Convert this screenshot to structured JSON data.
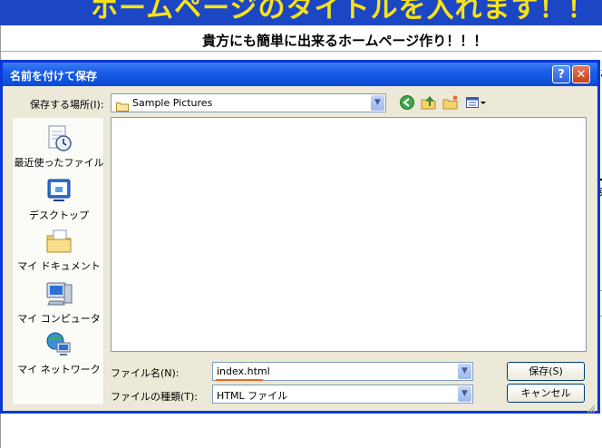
{
  "background_page": {
    "banner_title": "ホームページのタイトルを入れます！！",
    "subtitle": "貴方にも簡単に出来るホームページ作り！！！",
    "side_fragments": [
      "に",
      "い",
      "す"
    ]
  },
  "dialog": {
    "title": "名前を付けて保存",
    "help_button": "?",
    "close_button": "✕",
    "save_in_label": "保存する場所(I):",
    "save_in_value": "Sample Pictures",
    "places": [
      {
        "label": "最近使ったファイル",
        "icon": "recent-documents-icon"
      },
      {
        "label": "デスクトップ",
        "icon": "desktop-icon"
      },
      {
        "label": "マイ ドキュメント",
        "icon": "my-documents-icon"
      },
      {
        "label": "マイ コンピュータ",
        "icon": "my-computer-icon"
      },
      {
        "label": "マイ ネットワーク",
        "icon": "my-network-icon"
      }
    ],
    "filename_label": "ファイル名(N):",
    "filename_value": "index.html",
    "filetype_label": "ファイルの種類(T):",
    "filetype_value": "HTML ファイル",
    "save_button": "保存(S)",
    "cancel_button": "キャンセル",
    "colors": {
      "titlebar": "#0a4ad5",
      "dialog_bg": "#ece9d8",
      "banner": "#1b46c4",
      "banner_text": "#f7e21a"
    }
  }
}
